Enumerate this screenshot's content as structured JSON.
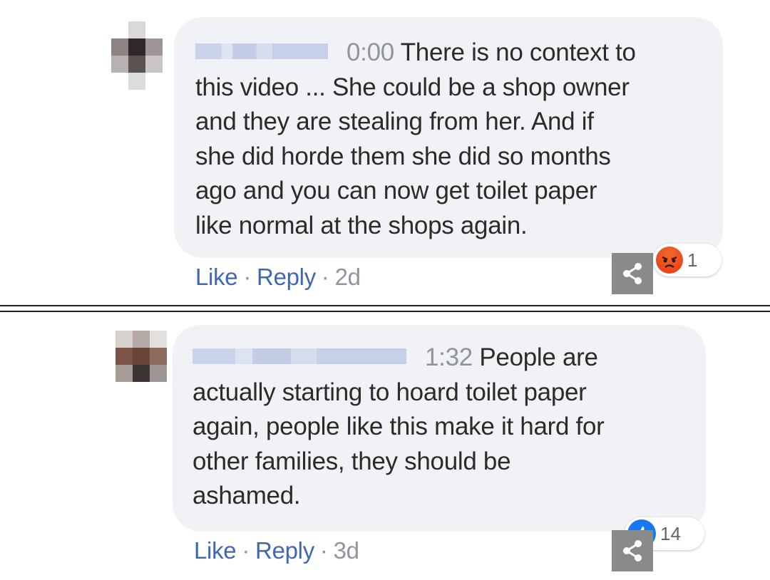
{
  "comments": [
    {
      "timestamp": "0:00",
      "lines": [
        "There is no context to",
        "this video ... She could be a shop owner",
        "and they are stealing from her. And if",
        "she did horde them she did so months",
        "ago and you can now get toilet paper",
        "like normal at the shops again."
      ],
      "actions": {
        "like": "Like",
        "reply": "Reply",
        "age": "2d",
        "separator": "·"
      },
      "reaction": {
        "type": "angry",
        "count": "1"
      }
    },
    {
      "timestamp": "1:32",
      "lines": [
        "People are",
        "actually starting to hoard toilet paper",
        "again, people like this make it hard for",
        "other families, they should be",
        "ashamed."
      ],
      "actions": {
        "like": "Like",
        "reply": "Reply",
        "age": "3d",
        "separator": "·"
      },
      "reaction": {
        "type": "like",
        "count": "14"
      }
    }
  ],
  "icons": {
    "share": "share-icon",
    "angry": "angry-reaction-icon",
    "like": "like-reaction-icon"
  },
  "colors": {
    "bubble": "#f0f2f5",
    "link": "#4267b2",
    "meta": "#90949c",
    "share_bg": "#8a8a8a"
  }
}
